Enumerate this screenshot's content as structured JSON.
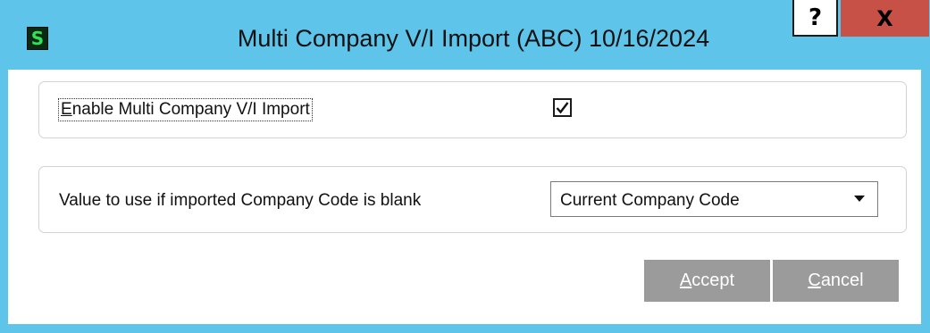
{
  "window": {
    "title": "Multi Company V/I Import (ABC) 10/16/2024",
    "app_icon_glyph": "S",
    "help_label": "?",
    "close_label": "X",
    "titlebar_color": "#5ec4ea",
    "close_color": "#c75047"
  },
  "enable_section": {
    "label_accel": "E",
    "label_rest": "nable Multi Company V/I Import",
    "checked": true
  },
  "company_code_section": {
    "label": "Value to use if imported Company Code is blank",
    "selected_value": "Current Company Code"
  },
  "buttons": {
    "accept_accel": "A",
    "accept_rest": "ccept",
    "cancel_accel": "C",
    "cancel_rest": "ancel",
    "color": "#9b9b9b"
  }
}
